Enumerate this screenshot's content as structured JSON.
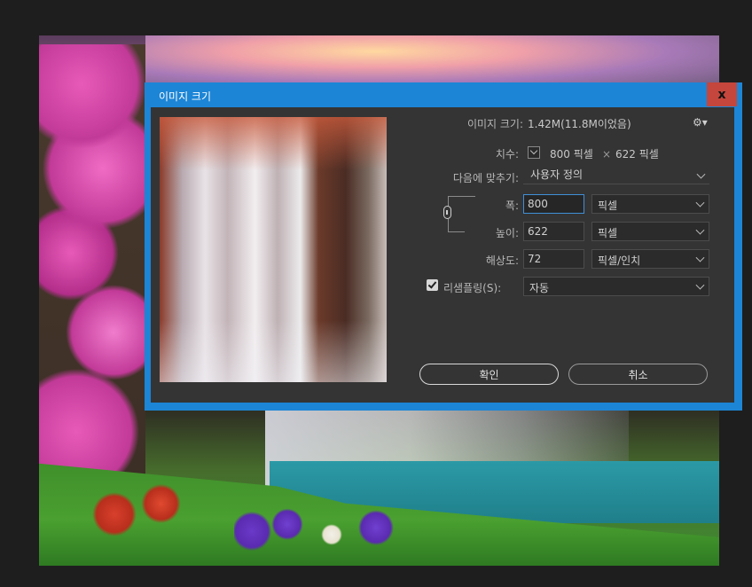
{
  "dialog": {
    "title": "이미지 크기",
    "close_label": "x"
  },
  "info": {
    "image_size_label": "이미지 크기:",
    "image_size_value": "1.42M(11.8M이었음)",
    "dimensions_label": "치수:",
    "dimensions_width": "800 픽셀",
    "dimensions_times": "×",
    "dimensions_height": "622 픽셀"
  },
  "fit_to": {
    "label": "다음에 맞추기:",
    "value": "사용자 정의"
  },
  "width": {
    "label": "폭:",
    "value": "800",
    "unit": "픽셀"
  },
  "height": {
    "label": "높이:",
    "value": "622",
    "unit": "픽셀"
  },
  "resolution": {
    "label": "해상도:",
    "value": "72",
    "unit": "픽셀/인치"
  },
  "resample": {
    "checked": true,
    "label": "리샘플링(S):",
    "value": "자동"
  },
  "buttons": {
    "ok": "확인",
    "cancel": "취소"
  },
  "icons": {
    "settings": "gear-icon",
    "link": "chain-link-icon",
    "dimensions_toggle": "chevron-down-icon",
    "close": "close-icon"
  },
  "colors": {
    "accent": "#1c85d6",
    "close": "#c4463c",
    "dialog_body": "#343434"
  }
}
